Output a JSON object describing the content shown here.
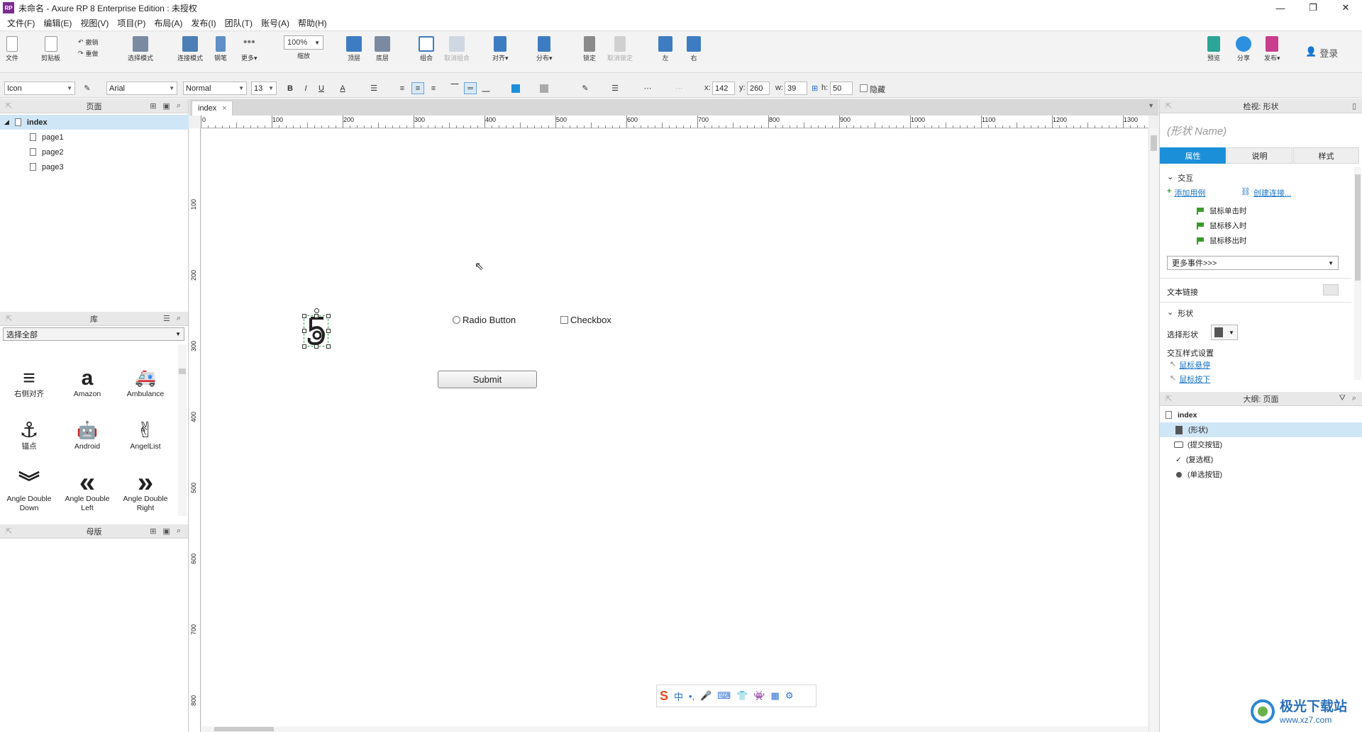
{
  "window": {
    "title": "未命名 - Axure RP 8 Enterprise Edition : 未授权",
    "logo": "RP",
    "controls": [
      "—",
      "❐",
      "✕"
    ]
  },
  "menu": [
    "文件(F)",
    "编辑(E)",
    "视图(V)",
    "项目(P)",
    "布局(A)",
    "发布(I)",
    "团队(T)",
    "账号(A)",
    "帮助(H)"
  ],
  "toolbar": {
    "file": "文件",
    "clipboard": "剪贴板",
    "undo": "撤销",
    "redo": "重做",
    "select_mode": "选择模式",
    "connect_mode": "连接模式",
    "pen": "钢笔",
    "more": "更多▾",
    "zoom_value": "100%",
    "zoom_label": "缩放",
    "top": "顶层",
    "bottom": "底层",
    "group": "组合",
    "ungroup": "取消组合",
    "align": "对齐▾",
    "distribute": "分布▾",
    "lock": "锁定",
    "unlock": "取消锁定",
    "left": "左",
    "right": "右",
    "preview": "预览",
    "share": "分享",
    "publish": "发布▾",
    "login": "登录"
  },
  "format": {
    "widget_type": "Icon",
    "font": "Arial",
    "style": "Normal",
    "size": "13",
    "bold": "B",
    "italic": "I",
    "underline": "U",
    "font_color": "A",
    "x_label": "x:",
    "x": "142",
    "y_label": "y:",
    "y": "260",
    "w_label": "w:",
    "w": "39",
    "h_label": "h:",
    "h": "50",
    "hidden_label": "隐藏"
  },
  "pages_panel": {
    "title": "页面",
    "items": [
      {
        "label": "index",
        "level": 0,
        "selected": true
      },
      {
        "label": "page1",
        "level": 1
      },
      {
        "label": "page2",
        "level": 1
      },
      {
        "label": "page3",
        "level": 1
      }
    ]
  },
  "library_panel": {
    "title": "库",
    "select": "选择全部",
    "items": [
      {
        "label": "右侧对齐",
        "icon": "≡"
      },
      {
        "label": "Amazon",
        "icon": "a"
      },
      {
        "label": "Ambulance",
        "icon": "🚑"
      },
      {
        "label": "锚点",
        "icon": "⚓"
      },
      {
        "label": "Android",
        "icon": "🤖"
      },
      {
        "label": "AngelList",
        "icon": "✌"
      },
      {
        "label": "Angle Double Down",
        "icon": "︾"
      },
      {
        "label": "Angle Double Left",
        "icon": "«"
      },
      {
        "label": "Angle Double Right",
        "icon": "»"
      }
    ]
  },
  "masters_panel": {
    "title": "母版"
  },
  "canvas": {
    "tab": "index",
    "tab_close": "×",
    "ruler_h": [
      "0",
      "100",
      "200",
      "300",
      "400",
      "500",
      "600",
      "700",
      "800",
      "900",
      "1000",
      "1100",
      "1200",
      "1300"
    ],
    "ruler_v": [
      "100",
      "200",
      "300",
      "400",
      "500",
      "600",
      "700",
      "800"
    ],
    "radio_label": "Radio Button",
    "checkbox_label": "Checkbox",
    "submit_label": "Submit"
  },
  "inspector": {
    "title": "检视: 形状",
    "name_placeholder": "(形状 Name)",
    "tabs": [
      "属性",
      "说明",
      "样式"
    ],
    "interaction_header": "交互",
    "add_case": "添加用例",
    "create_link": "创建连接...",
    "events": [
      "鼠标单击时",
      "鼠标移入时",
      "鼠标移出时"
    ],
    "more_events": "更多事件>>>",
    "text_link": "文本链接",
    "shape_header": "形状",
    "select_shape": "选择形状",
    "interaction_style": "交互样式设置",
    "hover": "鼠标悬停",
    "pressed": "鼠标按下"
  },
  "outline": {
    "title": "大纲: 页面",
    "root": "index",
    "items": [
      {
        "label": "(形状)",
        "icon": "shape",
        "selected": true
      },
      {
        "label": "(提交按钮)",
        "icon": "button"
      },
      {
        "label": "(复选框)",
        "icon": "check"
      },
      {
        "label": "(单选按钮)",
        "icon": "radio"
      }
    ]
  },
  "ime": {
    "items": [
      "S",
      "中",
      "•,",
      "🎤",
      "⌨",
      "👕",
      "👾",
      "▦",
      "⚙"
    ]
  },
  "watermark": {
    "text": "极光下载站",
    "url": "www.xz7.com"
  }
}
